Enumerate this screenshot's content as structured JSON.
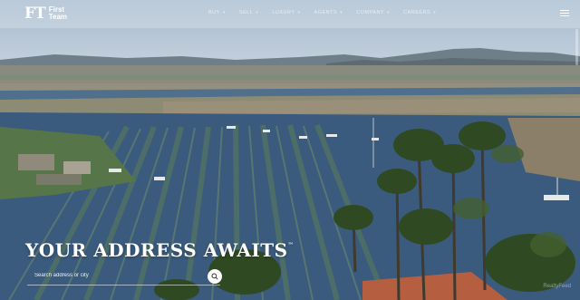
{
  "brand": {
    "mark": "FT",
    "line1": "First",
    "line2": "Team"
  },
  "nav": {
    "items": [
      {
        "label": "BUY"
      },
      {
        "label": "SELL"
      },
      {
        "label": "LUXURY"
      },
      {
        "label": "AGENTS"
      },
      {
        "label": "COMPANY"
      },
      {
        "label": "CAREERS"
      }
    ],
    "chevron": "▾"
  },
  "hero": {
    "headline": "YOUR ADDRESS AWAITS",
    "trademark": "™",
    "search": {
      "placeholder": "Search address or city"
    }
  },
  "watermark": "RealtyFeed",
  "icons": {
    "menu": "hamburger-icon",
    "search": "magnifier-icon"
  },
  "colors": {
    "water": "#3d5f83",
    "sky": "#b6c6d6",
    "accent": "#ffffff"
  }
}
